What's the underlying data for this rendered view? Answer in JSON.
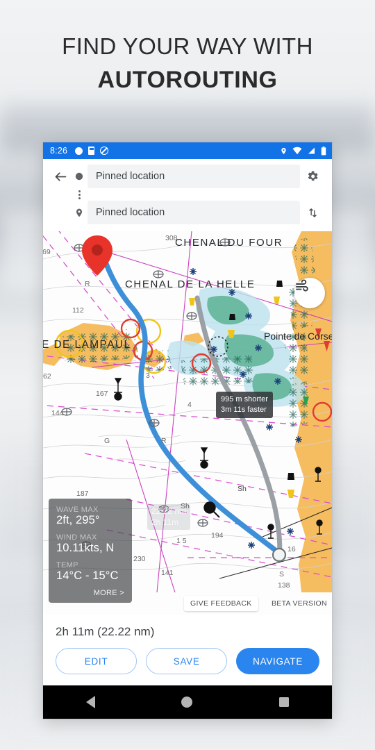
{
  "headline": {
    "line1": "FIND YOUR WAY WITH",
    "line2": "AUTOROUTING"
  },
  "phone": {
    "statusbar": {
      "time": "8:26",
      "left_icons": [
        "notification-dot-icon",
        "sim-card-icon",
        "do-not-disturb-icon"
      ],
      "right_icons": [
        "location-icon",
        "wifi-icon",
        "signal-icon",
        "battery-icon"
      ],
      "background_color": "#1273e6"
    },
    "search": {
      "back_icon": "back-arrow-icon",
      "origin": {
        "icon": "circle-origin-icon",
        "value": "Pinned location",
        "placeholder": "Pinned location"
      },
      "middle_icon": "vertical-dots-icon",
      "destination": {
        "icon": "map-pin-icon",
        "value": "Pinned location",
        "placeholder": "Pinned location"
      },
      "settings_icon": "gear-icon",
      "swap_icon": "swap-vertical-icon"
    },
    "map": {
      "labels": {
        "chenal_du_four": "CHENAL DU FOUR",
        "chenal_de_la_helle": "CHENAL DE LA HELLE",
        "lampaul": "E DE LAMPAUL",
        "pointe_de_corse": "Pointe de Corse",
        "sh_1": "Sh",
        "sh_2": "Sh"
      },
      "soundings": [
        "308",
        "69",
        "112",
        "62",
        "167",
        "144",
        "230",
        "141",
        "194",
        "138",
        "187",
        "3",
        "4",
        "16",
        "R",
        "R",
        "G",
        "S",
        "1 5"
      ],
      "wind_layer_icon": "wind-icon",
      "route_tooltip": {
        "line1": "995 m shorter",
        "line2": "3m 11s faster"
      },
      "alt_route_label": {
        "line1": "22.22 nm",
        "line2": "2h 11m"
      },
      "route_color": "#3d8fd8",
      "alt_route_color": "#9aa0a6",
      "marker_color": "#e8332a",
      "land_color": "#f6bd60"
    },
    "weather": {
      "wave_label": "WAVE MAX",
      "wave_value": "2ft, 295°",
      "wind_label": "WIND MAX",
      "wind_value": "10.11kts, N",
      "temp_label": "TEMP",
      "temp_value": "14°C - 15°C",
      "more_label": "MORE >"
    },
    "chips": {
      "feedback": "GIVE FEEDBACK",
      "beta": "BETA VERSION"
    },
    "sheet": {
      "eta": "2h 11m (22.22 nm)",
      "edit_label": "EDIT",
      "save_label": "SAVE",
      "navigate_label": "NAVIGATE",
      "accent_color": "#2b85ef"
    },
    "navbar": {
      "back_icon": "nav-back-triangle-icon",
      "home_icon": "nav-home-circle-icon",
      "recents_icon": "nav-recents-square-icon"
    }
  }
}
